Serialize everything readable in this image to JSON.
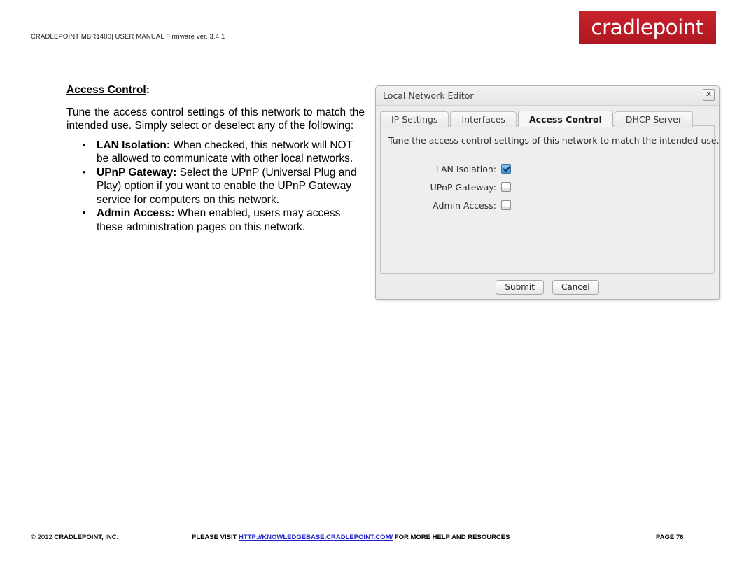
{
  "header": {
    "manual_line": "CRADLEPOINT MBR1400| USER MANUAL Firmware ver. 3.4.1",
    "logo_text": "cradlepoint",
    "logo_color": "#c1202a"
  },
  "article": {
    "heading": "Access Control",
    "heading_colon": ":",
    "intro": "Tune the access control settings of this network to match the intended use. Simply select or deselect any of the following:",
    "bullets": [
      {
        "term": "LAN Isolation:",
        "text": " When checked, this network will NOT be allowed to communicate with other local networks."
      },
      {
        "term": "UPnP Gateway:",
        "text": " Select the UPnP (Universal Plug and Play) option if you want to enable the UPnP Gateway service for computers on this network."
      },
      {
        "term": "Admin Access:",
        "text": " When enabled, users may access these administration pages on this network."
      }
    ]
  },
  "dialog": {
    "title": "Local Network Editor",
    "close_icon": "✕",
    "tabs": [
      {
        "label": "IP Settings",
        "active": false
      },
      {
        "label": "Interfaces",
        "active": false
      },
      {
        "label": "Access Control",
        "active": true
      },
      {
        "label": "DHCP Server",
        "active": false
      }
    ],
    "panel": {
      "description": "Tune the access control settings of this network to match the intended use.",
      "fields": [
        {
          "label": "LAN Isolation:",
          "checked": true
        },
        {
          "label": "UPnP Gateway:",
          "checked": false
        },
        {
          "label": "Admin Access:",
          "checked": false
        }
      ]
    },
    "buttons": {
      "submit": "Submit",
      "cancel": "Cancel"
    },
    "checked_color": "#5aa7e6"
  },
  "footer": {
    "copyright_symbol": "© 2012 ",
    "company": "CRADLEPOINT, INC.",
    "visit_prefix": "PLEASE VISIT ",
    "url": "HTTP://KNOWLEDGEBASE.CRADLEPOINT.COM/",
    "visit_suffix": " FOR MORE HELP AND RESOURCES",
    "page_label": "PAGE 76"
  }
}
